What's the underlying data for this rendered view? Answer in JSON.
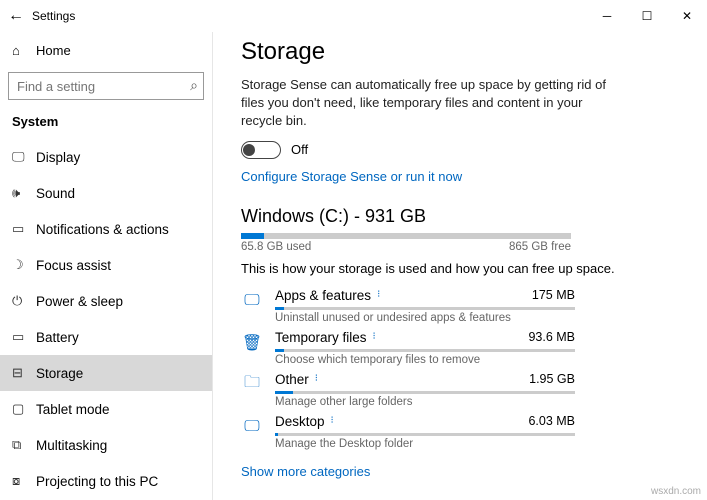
{
  "titlebar": {
    "title": "Settings"
  },
  "sidebar": {
    "home": "Home",
    "search_placeholder": "Find a setting",
    "section": "System",
    "items": [
      {
        "label": "Display"
      },
      {
        "label": "Sound"
      },
      {
        "label": "Notifications & actions"
      },
      {
        "label": "Focus assist"
      },
      {
        "label": "Power & sleep"
      },
      {
        "label": "Battery"
      },
      {
        "label": "Storage"
      },
      {
        "label": "Tablet mode"
      },
      {
        "label": "Multitasking"
      },
      {
        "label": "Projecting to this PC"
      }
    ]
  },
  "main": {
    "title": "Storage",
    "desc": "Storage Sense can automatically free up space by getting rid of files you don't need, like temporary files and content in your recycle bin.",
    "toggle_label": "Off",
    "configure_link": "Configure Storage Sense or run it now",
    "drive_title": "Windows (C:) - 931 GB",
    "used": "65.8 GB used",
    "free": "865 GB free",
    "hint": "This is how your storage is used and how you can free up space.",
    "categories": [
      {
        "name": "Apps & features",
        "size": "175 MB",
        "sub": "Uninstall unused or undesired apps & features"
      },
      {
        "name": "Temporary files",
        "size": "93.6 MB",
        "sub": "Choose which temporary files to remove"
      },
      {
        "name": "Other",
        "size": "1.95 GB",
        "sub": "Manage other large folders"
      },
      {
        "name": "Desktop",
        "size": "6.03 MB",
        "sub": "Manage the Desktop folder"
      }
    ],
    "show_more": "Show more categories"
  },
  "watermark": "wsxdn.com"
}
